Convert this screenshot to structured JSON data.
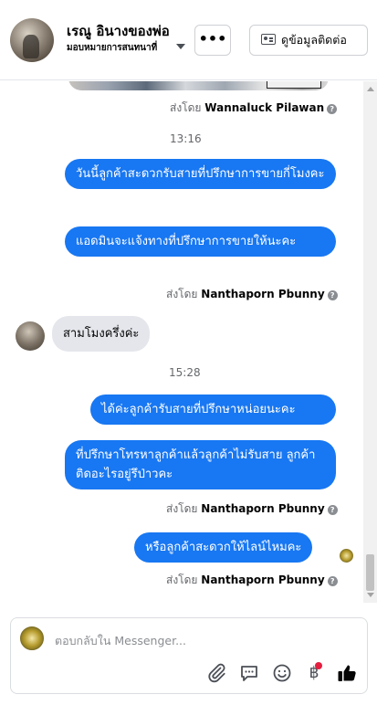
{
  "header": {
    "contact_name": "เรณู อินางของพ่อ",
    "subtitle": "มอบหมายการสนทนาที่",
    "more_label": "•••",
    "contact_info_label": "ดูข้อมูลติดต่อ"
  },
  "messages": {
    "sent_by_1_prefix": "ส่งโดย",
    "sent_by_1_name": "Wannaluck Pilawan",
    "time_1": "13:16",
    "out_1": "วันนี้ลูกค้าสะดวกรับสายที่ปรึกษาการขายกี่โมงคะ",
    "out_2": "แอดมินจะแจ้งทางที่ปรึกษาการขายให้นะคะ",
    "sent_by_2_prefix": "ส่งโดย",
    "sent_by_2_name": "Nanthaporn Pbunny",
    "in_1": "สามโมงครึ่งค่ะ",
    "time_2": "15:28",
    "out_3": "ได้ค่ะลูกค้ารับสายที่ปรึกษาหน่อยนะคะ",
    "out_4": "ที่ปรึกษาโทรหาลูกค้าแล้วลูกค้าไม่รับสาย ลูกค้าติดอะไรอยู่รึป่าวคะ",
    "sent_by_3_prefix": "ส่งโดย",
    "sent_by_3_name": "Nanthaporn Pbunny",
    "out_5": "หรือลูกค้าสะดวกให้ไลน์ไหมคะ",
    "sent_by_4_prefix": "ส่งโดย",
    "sent_by_4_name": "Nanthaporn Pbunny"
  },
  "composer": {
    "placeholder": "ตอบกลับใน Messenger...",
    "currency_symbol": "฿"
  },
  "icons": [
    "paperclip-icon",
    "saved-reply-icon",
    "emoji-icon",
    "payment-icon",
    "like-icon",
    "chevron-down-icon",
    "info-icon"
  ],
  "colors": {
    "outgoing_bubble": "#1877f2",
    "incoming_bubble": "#e4e6eb",
    "badge": "#e41e3f"
  }
}
